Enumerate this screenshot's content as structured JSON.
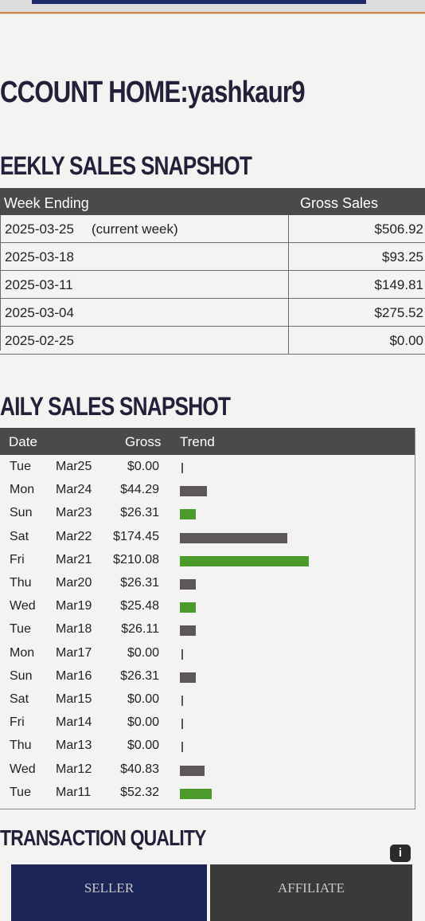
{
  "account": {
    "title": "CCOUNT HOME:yashkaur9"
  },
  "weekly": {
    "title": "EEKLY SALES SNAPSHOT",
    "headers": {
      "week": "Week Ending",
      "gross": "Gross Sales"
    },
    "rows": [
      {
        "week": "2025-03-25",
        "note": "(current week)",
        "gross": "$506.92"
      },
      {
        "week": "2025-03-18",
        "note": "",
        "gross": "$93.25"
      },
      {
        "week": "2025-03-11",
        "note": "",
        "gross": "$149.81"
      },
      {
        "week": "2025-03-04",
        "note": "",
        "gross": "$275.52"
      },
      {
        "week": "2025-02-25",
        "note": "",
        "gross": "$0.00"
      }
    ]
  },
  "daily": {
    "title": "AILY SALES SNAPSHOT",
    "headers": {
      "date": "Date",
      "gross": "Gross",
      "trend": "Trend"
    },
    "trend_colors": {
      "seller": "#5e5757",
      "affiliate": "#4c9a2a"
    },
    "rows": [
      {
        "day": "Tue",
        "date": "Mar25",
        "gross": "$0.00",
        "value": 0.0,
        "color": "gray"
      },
      {
        "day": "Mon",
        "date": "Mar24",
        "gross": "$44.29",
        "value": 44.29,
        "color": "gray"
      },
      {
        "day": "Sun",
        "date": "Mar23",
        "gross": "$26.31",
        "value": 26.31,
        "color": "green"
      },
      {
        "day": "Sat",
        "date": "Mar22",
        "gross": "$174.45",
        "value": 174.45,
        "color": "gray"
      },
      {
        "day": "Fri",
        "date": "Mar21",
        "gross": "$210.08",
        "value": 210.08,
        "color": "green"
      },
      {
        "day": "Thu",
        "date": "Mar20",
        "gross": "$26.31",
        "value": 26.31,
        "color": "gray"
      },
      {
        "day": "Wed",
        "date": "Mar19",
        "gross": "$25.48",
        "value": 25.48,
        "color": "green"
      },
      {
        "day": "Tue",
        "date": "Mar18",
        "gross": "$26.11",
        "value": 26.11,
        "color": "gray"
      },
      {
        "day": "Mon",
        "date": "Mar17",
        "gross": "$0.00",
        "value": 0.0,
        "color": "gray"
      },
      {
        "day": "Sun",
        "date": "Mar16",
        "gross": "$26.31",
        "value": 26.31,
        "color": "gray"
      },
      {
        "day": "Sat",
        "date": "Mar15",
        "gross": "$0.00",
        "value": 0.0,
        "color": "gray"
      },
      {
        "day": "Fri",
        "date": "Mar14",
        "gross": "$0.00",
        "value": 0.0,
        "color": "gray"
      },
      {
        "day": "Thu",
        "date": "Mar13",
        "gross": "$0.00",
        "value": 0.0,
        "color": "gray"
      },
      {
        "day": "Wed",
        "date": "Mar12",
        "gross": "$40.83",
        "value": 40.83,
        "color": "gray"
      },
      {
        "day": "Tue",
        "date": "Mar11",
        "gross": "$52.32",
        "value": 52.32,
        "color": "green"
      }
    ]
  },
  "quality": {
    "title": "TRANSACTION QUALITY",
    "info_icon": "i"
  },
  "tabs": {
    "seller": "SELLER",
    "affiliate": "AFFILIATE"
  }
}
